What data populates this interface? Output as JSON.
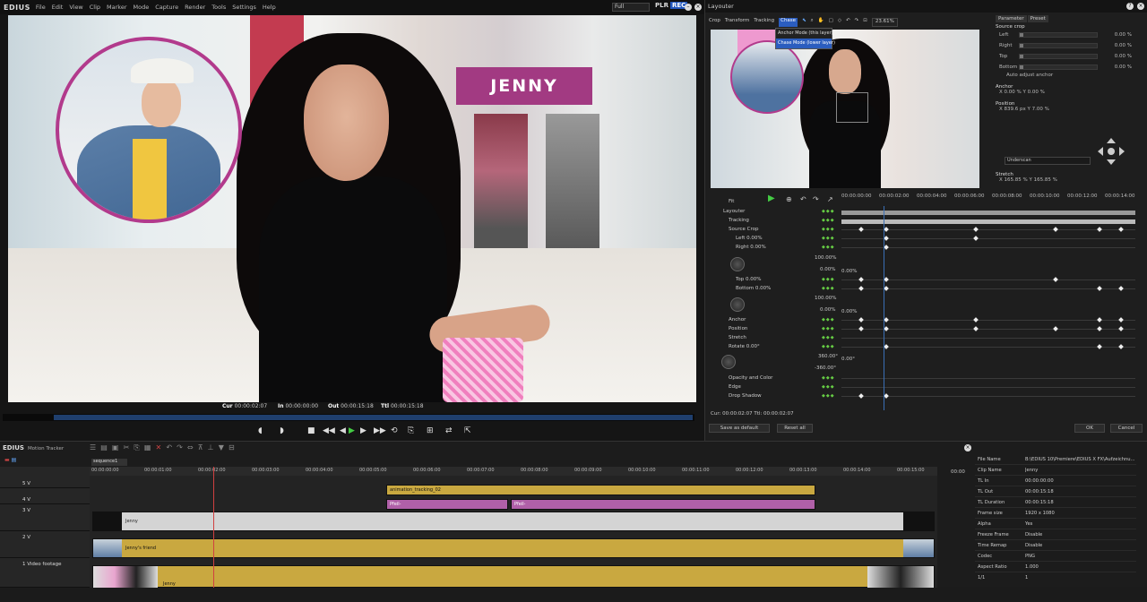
{
  "app": {
    "logo": "EDIUS",
    "menu": [
      "File",
      "Edit",
      "View",
      "Clip",
      "Marker",
      "Mode",
      "Capture",
      "Render",
      "Tools",
      "Settings",
      "Help"
    ],
    "mode_select": "Full",
    "plr": "PLR",
    "rec": "REC"
  },
  "preview": {
    "title_text": "JENNY",
    "cur_label": "Cur",
    "cur": "00:00:02:07",
    "in_label": "In",
    "in": "00:00:00:00",
    "out_label": "Out",
    "out": "00:00:15:18",
    "ttl_label": "Ttl",
    "ttl": "00:00:15:18"
  },
  "layouter": {
    "title": "Layouter",
    "tabs": [
      "Crop",
      "Transform",
      "Tracking"
    ],
    "chase": "Chase",
    "chase_options": [
      "Anchor Mode (this layer)",
      "Chase Mode (lower layer)"
    ],
    "zoom": "23.61%",
    "param_tabs": [
      "Parameter",
      "Preset"
    ],
    "source_crop": "Source crop",
    "crop_rows": [
      {
        "label": "Left",
        "value": "0.00 %"
      },
      {
        "label": "Right",
        "value": "0.00 %"
      },
      {
        "label": "Top",
        "value": "0.00 %"
      },
      {
        "label": "Bottom",
        "value": "0.00 %"
      }
    ],
    "auto_adjust": "Auto adjust anchor",
    "anchor": "Anchor",
    "anchor_xy": "X    0.00 %    Y    0.00 %",
    "position": "Position",
    "position_xy": "X    839.6 px    Y    7.00 %",
    "underscan": "Underscan",
    "stretch": "Stretch",
    "stretch_xy": "X    165.85 %    Y    165.85 %",
    "fit": "Fit",
    "timeline_ticks": [
      "00:00:00:00",
      "00:00:02:00",
      "00:00:04:00",
      "00:00:06:00",
      "00:00:08:00",
      "00:00:10:00",
      "00:00:12:00",
      "00:00:14:00"
    ],
    "tracks": [
      {
        "name": "Layouter"
      },
      {
        "name": "Tracking"
      },
      {
        "name": "Source Crop"
      },
      {
        "name": "Left 0.00%"
      },
      {
        "name": "Right 0.00%"
      },
      {
        "name": "Top 0.00%"
      },
      {
        "name": "Bottom 0.00%"
      },
      {
        "name": "Anchor"
      },
      {
        "name": "Position"
      },
      {
        "name": "Stretch"
      },
      {
        "name": "Rotate 0.00°"
      },
      {
        "name": "Opacity and Color"
      },
      {
        "name": "Edge"
      },
      {
        "name": "Drop Shadow"
      }
    ],
    "graph_vals": {
      "right_hi": "100.00%",
      "right_lo": "0.00%",
      "right_mid": "0.00%",
      "bottom_hi": "100.00%",
      "bottom_lo": "0.00%",
      "bottom_mid": "0.00%",
      "rot_hi": "360.00°",
      "rot_lo": "-360.00°",
      "rot_mid": "0.00°"
    },
    "cur_ttl": "Cur: 00:00:02:07   Ttl: 00:00:02:07",
    "save_default": "Save as default",
    "reset_all": "Reset all",
    "ok": "OK",
    "cancel": "Cancel"
  },
  "timeline": {
    "logo": "EDIUS",
    "subtitle": "Motion Tracker",
    "sequence_tab": "sequence1",
    "ruler": [
      "00:00:00:00",
      "00:00:01:00",
      "00:00:02:00",
      "00:00:03:00",
      "00:00:04:00",
      "00:00:05:00",
      "00:00:06:00",
      "00:00:07:00",
      "00:00:08:00",
      "00:00:09:00",
      "00:00:10:00",
      "00:00:11:00",
      "00:00:12:00",
      "00:00:13:00",
      "00:00:14:00",
      "00:00:15:00"
    ],
    "ruler_end": "00:00",
    "tracks": [
      "5 V",
      "4 V",
      "3 V",
      "2 V",
      "1 Video footage"
    ],
    "clips": {
      "animation": "animation_tracking_02",
      "pfeil1": "Pfeil-",
      "pfeil2": "Pfeil-",
      "jenny3": "Jenny",
      "friend": "Jenny's friend",
      "jenny1": "Jenny"
    }
  },
  "properties": [
    {
      "k": "File Name",
      "v": "B:\\EDIUS 10\\Premiere\\EDIUS X FX\\Aufzeichnu..."
    },
    {
      "k": "Clip Name",
      "v": "Jenny"
    },
    {
      "k": "TL In",
      "v": "00:00:00:00"
    },
    {
      "k": "TL Out",
      "v": "00:00:15:18"
    },
    {
      "k": "TL Duration",
      "v": "00:00:15:18"
    },
    {
      "k": "Frame size",
      "v": "1920 x 1080"
    },
    {
      "k": "Alpha",
      "v": "Yes"
    },
    {
      "k": "Freeze Frame",
      "v": "Disable"
    },
    {
      "k": "Time Remap",
      "v": "Disable"
    },
    {
      "k": "Codec",
      "v": "PNG"
    },
    {
      "k": "Aspect Ratio",
      "v": "1.000"
    }
  ],
  "props_footer": {
    "page": "1/1",
    "count": "1"
  },
  "colors": {
    "accent": "#2b5dbf",
    "title_box": "#a23a82",
    "clip_gold": "#c9a840",
    "clip_pink": "#b060a8",
    "keyframe_green": "#66cc44"
  }
}
